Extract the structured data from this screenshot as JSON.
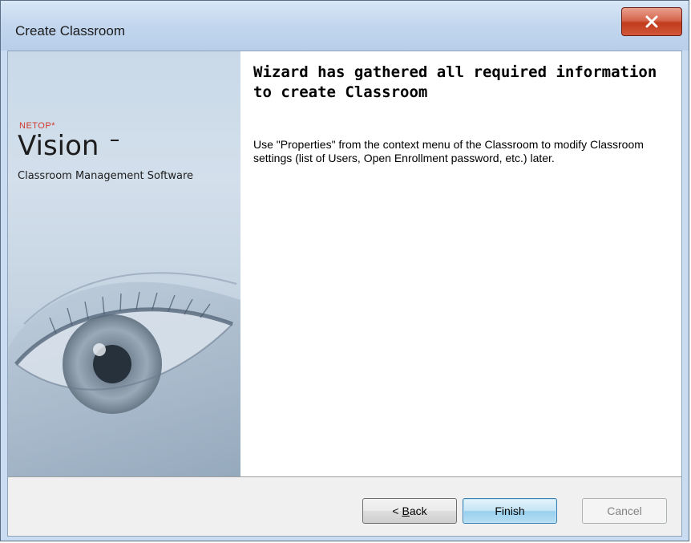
{
  "window": {
    "title": "Create Classroom",
    "close_icon": "close-icon"
  },
  "side_panel": {
    "brand_small": "NETOP*",
    "brand_name": "Vision",
    "tagline": "Classroom Management Software",
    "image": "eye-illustration"
  },
  "content": {
    "heading": "Wizard has gathered all required information to create Classroom",
    "body": "Use \"Properties\" from the context menu of the Classroom to modify Classroom settings (list of Users, Open Enrollment password, etc.) later."
  },
  "buttons": {
    "back_accel": "B",
    "back_rest": "ack",
    "back_prefix": "< ",
    "finish": "Finish",
    "cancel": "Cancel"
  },
  "colors": {
    "title_bar": "#c3d7ee",
    "close_button": "#c23a1c",
    "brand_red": "#d0382b",
    "default_button_border": "#3c7fb1",
    "footer": "#f0f0f0"
  }
}
